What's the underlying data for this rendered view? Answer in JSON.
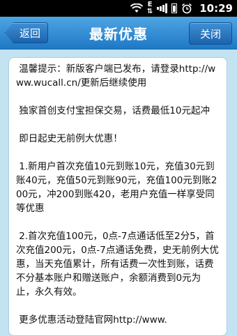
{
  "status": {
    "time": "10:29"
  },
  "header": {
    "title": "最新优惠",
    "back_label": "返回",
    "close_label": "关闭"
  },
  "content": {
    "p1": " 温馨提示：新版客户端已发布，请登录http://www.wucall.cn/更新后继续使用",
    "p2": " 独家首创支付宝担保交易，话费最低10元起冲",
    "p3": " 即日起史无前例大优惠！",
    "p4": " 1.新用户首次充值10元到账10元，充值30元到账40元，充值50元到账90元，充值100元到账200元，冲200到账420，老用户充值一样享受同等优惠",
    "p5": " 2.首次充值100元，0点-7点通话低至2分5，首次充值200元，0点-7点通话免费，史无前例大优惠，当天充值累计，所有话费一次性到账，话费不分基本账户和赠送账户，余额消费到0元为止，永久有效。",
    "p6": " 更多优惠活动登陆官网http://www."
  }
}
